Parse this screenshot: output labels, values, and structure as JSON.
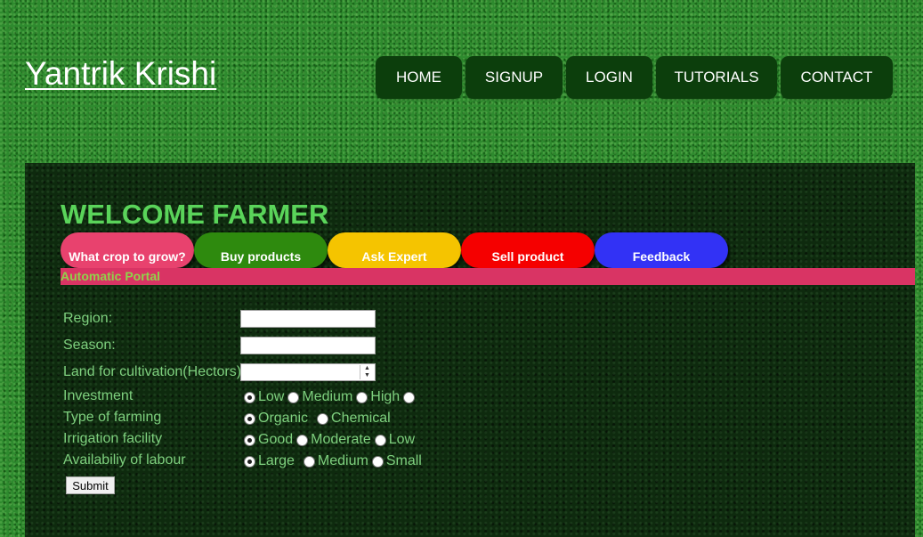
{
  "site": {
    "logo": "Yantrik Krishi"
  },
  "nav": {
    "items": [
      {
        "label": "HOME"
      },
      {
        "label": "SIGNUP"
      },
      {
        "label": "LOGIN"
      },
      {
        "label": "TUTORIALS"
      },
      {
        "label": "CONTACT"
      }
    ],
    "background": "#0c3e0c"
  },
  "main": {
    "heading": "WELCOME FARMER",
    "tabs": [
      {
        "label": "What crop to grow?",
        "color": "#e8426e"
      },
      {
        "label": "Buy products",
        "color": "#2e8a0e"
      },
      {
        "label": "Ask Expert",
        "color": "#f5c400"
      },
      {
        "label": "Sell product",
        "color": "#f50000"
      },
      {
        "label": "Feedback",
        "color": "#3232f5"
      }
    ],
    "portal_label": "Automatic Portal",
    "portal_bar_color": "#d93464"
  },
  "form": {
    "region_label": "Region:",
    "region_value": "",
    "season_label": "Season:",
    "season_value": "",
    "land_label": "Land for cultivation(Hectors)",
    "land_value": "",
    "investment": {
      "label": "Investment",
      "options": [
        "Low",
        "Medium",
        "High",
        ""
      ],
      "selected": "Low"
    },
    "farming": {
      "label": "Type of farming",
      "options": [
        "Organic",
        "Chemical"
      ],
      "selected": "Organic"
    },
    "irrigation": {
      "label": "Irrigation facility",
      "options": [
        "Good",
        "Moderate",
        "Low"
      ],
      "selected": "Good"
    },
    "labour": {
      "label": "Availabiliy of labour",
      "options": [
        "Large",
        "Medium",
        "Small"
      ],
      "selected": "Large"
    },
    "submit_label": "Submit"
  }
}
